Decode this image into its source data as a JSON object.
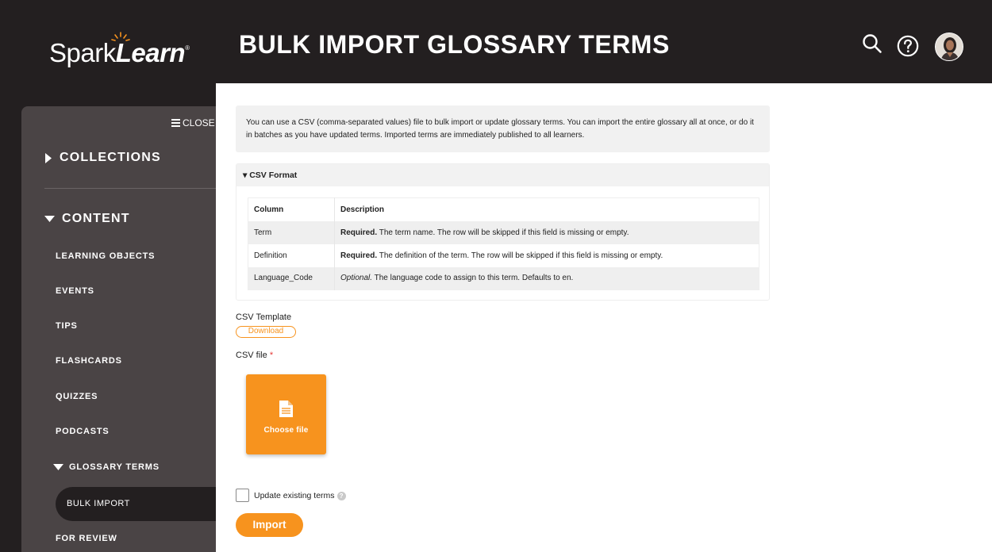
{
  "brand": {
    "logo_name_1": "Spark",
    "logo_name_2": "Learn",
    "logo_mark": "®",
    "accent": "#f7931e"
  },
  "header": {
    "title": "BULK IMPORT GLOSSARY TERMS",
    "icons": [
      "search-icon",
      "help-icon",
      "avatar"
    ]
  },
  "sidebar": {
    "close_label": "CLOSE",
    "sections": [
      {
        "label": "COLLECTIONS",
        "expanded": false
      },
      {
        "label": "CONTENT",
        "expanded": true
      }
    ],
    "items": [
      "LEARNING OBJECTS",
      "EVENTS",
      "TIPS",
      "FLASHCARDS",
      "QUIZZES",
      "PODCASTS"
    ],
    "glossary": {
      "label": "GLOSSARY TERMS",
      "expanded": true,
      "children": [
        "BULK IMPORT",
        "FOR REVIEW"
      ],
      "active": "BULK IMPORT"
    }
  },
  "main": {
    "intro": "You can use a CSV (comma-separated values) file to bulk import or update glossary terms. You can import the entire glossary all at once, or do it in batches as you have updated terms. Imported terms are immediately published to all learners.",
    "csv_format": {
      "heading": "CSV Format",
      "columns": [
        "Column",
        "Description"
      ],
      "rows": [
        {
          "column": "Term",
          "lead": "Required.",
          "desc": " The term name. The row will be skipped if this field is missing or empty."
        },
        {
          "column": "Definition",
          "lead": "Required.",
          "desc": " The definition of the term. The row will be skipped if this field is missing or empty."
        },
        {
          "column": "Language_Code",
          "lead": "Optional.",
          "desc": " The language code to assign to this term. Defaults to en."
        }
      ]
    },
    "template_label": "CSV Template",
    "download_label": "Download",
    "file_label": "CSV file",
    "required_mark": "*",
    "choose_file_label": "Choose file",
    "update_existing_label": "Update existing terms",
    "update_existing_checked": false,
    "help_glyph": "?",
    "import_label": "Import"
  }
}
